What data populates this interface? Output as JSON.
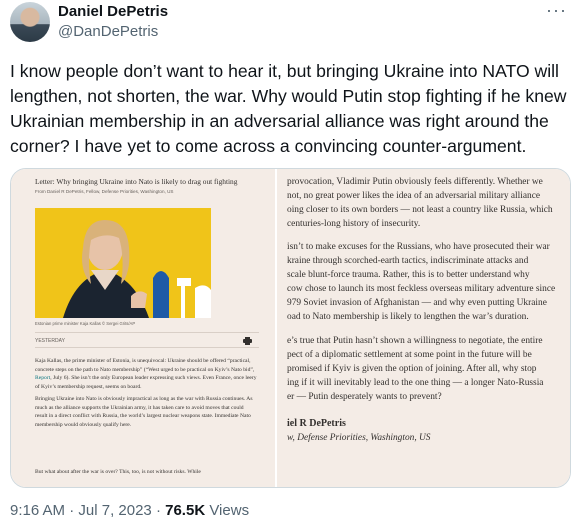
{
  "author": {
    "display_name": "Daniel DePetris",
    "handle": "@DanDePetris",
    "more_icon": "more-dots-icon"
  },
  "tweet": {
    "text": "I know people don’t want to hear it, but bringing Ukraine into NATO will lengthen, not shorten, the war. Why would Putin stop fighting if he knew Ukrainian membership in an adversarial alliance was right around the corner? I have yet to come across a convincing counter-argument."
  },
  "media": {
    "left": {
      "headline": "Letter: Why bringing Ukraine into Nato is likely to drag out fighting",
      "from": "From Daniel R DePetris, Fellow, Defense Priorities, Washington, US",
      "caption": "Estonian prime minister Kaja Kallas © Sergei Grits/AP",
      "yesterday": "YESTERDAY",
      "print_icon": "printer-icon",
      "p1_a": "Kaja Kallas, the prime minister of Estonia, is unequivocal: Ukraine should be offered “practical, concrete steps on the path to Nato membership” (“West urged to be practical on Kyiv’s Nato bid”, ",
      "p1_link": "Report",
      "p1_b": ", July 6). She isn’t the only European leader expressing such views. Even France, once leery of Kyiv’s membership request, seems on board.",
      "p2": "Bringing Ukraine into Nato is obviously impractical as long as the war with Russia continues. As much as the alliance supports the Ukrainian army, it has taken care to avoid moves that could result in a direct conflict with Russia, the world’s largest nuclear weapons state. Immediate Nato membership would obviously qualify here.",
      "p3": "But what about after the war is over? This, too, is not without risks. While"
    },
    "right": {
      "p1": [
        "provocation, Vladimir Putin obviously feels differently. Whether we",
        "not, no great power likes the idea of an adversarial military alliance",
        "oing closer to its own borders — not least a country like Russia, which",
        "centuries-long history of insecurity."
      ],
      "p2": [
        "isn’t to make excuses for the Russians, who have prosecuted their war",
        "kraine through scorched-earth tactics, indiscriminate attacks and",
        "scale blunt-force trauma. Rather, this is to better understand why",
        "cow chose to launch its most feckless overseas military adventure since",
        "979 Soviet invasion of Afghanistan — and why even putting Ukraine",
        "oad to Nato membership is likely to lengthen the war’s duration."
      ],
      "p3": [
        "e’s true that Putin hasn’t shown a willingness to negotiate, the entire",
        "pect of a diplomatic settlement at some point in the future will be",
        "promised if Kyiv is given the option of joining. After all, why stop",
        "ing if it will inevitably lead to the one thing — a longer Nato-Russia",
        "er — Putin desperately wants to prevent?"
      ],
      "signature": "iel R DePetris",
      "affiliation": "w, Defense Priorities, Washington, US"
    }
  },
  "meta": {
    "time": "9:16 AM",
    "sep1": " · ",
    "date": "Jul 7, 2023",
    "sep2": " · ",
    "views_count": "76.5K",
    "views_label": " Views"
  }
}
